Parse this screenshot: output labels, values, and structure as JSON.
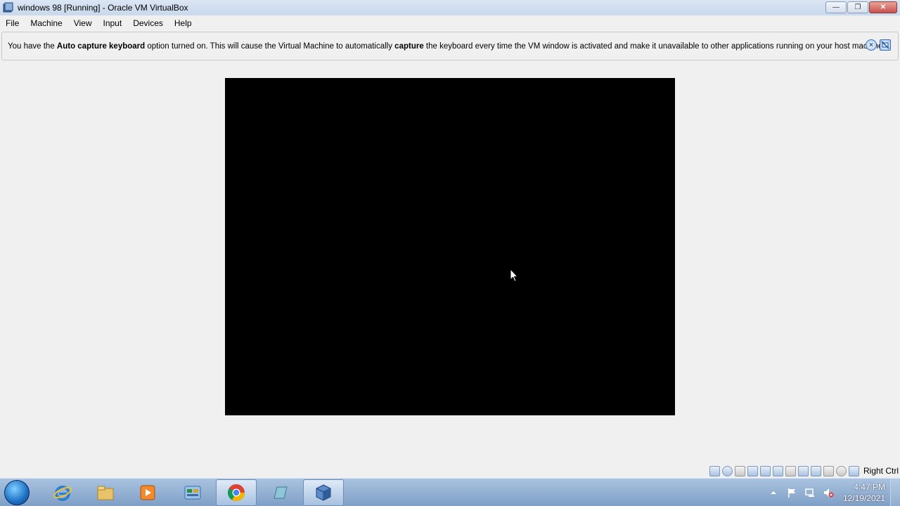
{
  "window": {
    "title": "windows 98 [Running] - Oracle VM VirtualBox",
    "minimize": "—",
    "restore": "❐",
    "close": "✕"
  },
  "menu": [
    "File",
    "Machine",
    "View",
    "Input",
    "Devices",
    "Help"
  ],
  "notification": {
    "part1": "You have the ",
    "bold1": "Auto capture keyboard",
    "part2": " option turned on. This will cause the Virtual Machine to automatically ",
    "bold2": "capture",
    "part3": " the keyboard every time the VM window is activated and make it unavailable to other applications running on your host machine:"
  },
  "statusbar": {
    "host_key": "Right Ctrl"
  },
  "taskbar": {
    "time": "4:47 PM",
    "date": "12/19/2021"
  },
  "colors": {
    "vm_screen": "#000000",
    "taskbar": "#8fadd2"
  }
}
